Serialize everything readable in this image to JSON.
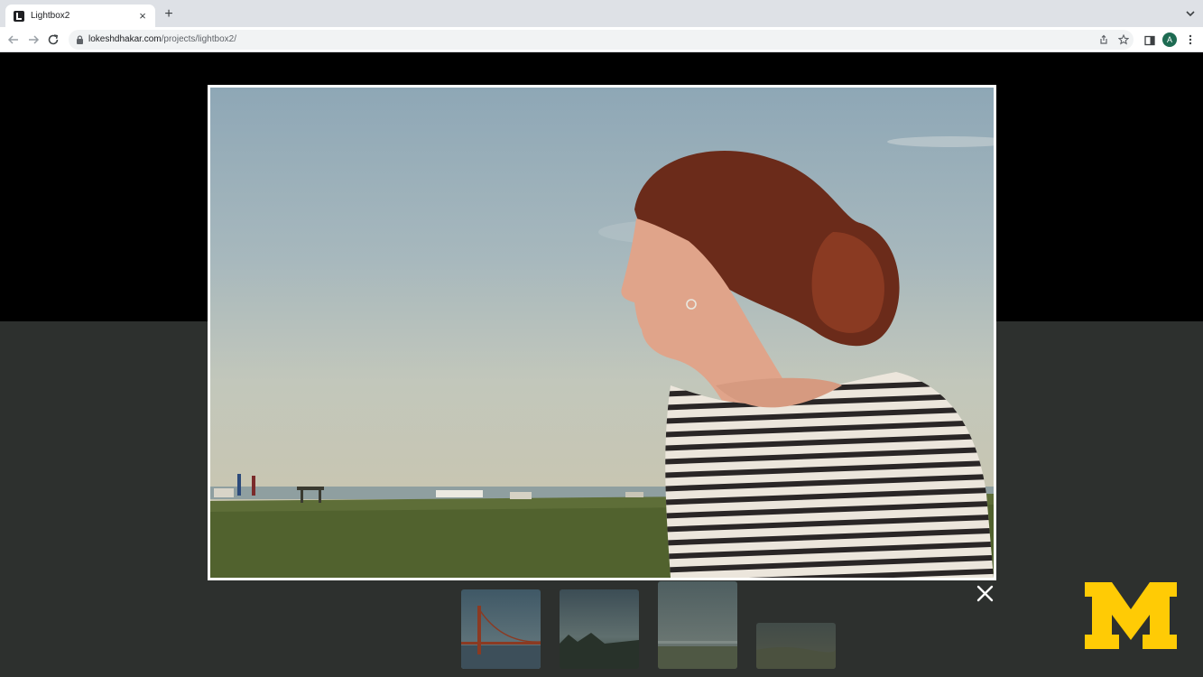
{
  "browser": {
    "tab": {
      "title": "Lightbox2",
      "close_icon": "close-icon"
    },
    "new_tab_icon": "plus-icon",
    "address_bar": {
      "domain": "lokeshdhakar.com",
      "path": "/projects/lightbox2/"
    },
    "profile_initial": "A",
    "colors": {
      "profile": "#1e6b52",
      "tab_strip": "#dee1e6"
    }
  },
  "lightbox": {
    "image_description_icon": "photo-woman-striped-shirt",
    "thumbnails": [
      {
        "icon": "thumbnail-golden-gate-bridge"
      },
      {
        "icon": "thumbnail-misty-landscape"
      },
      {
        "icon": "thumbnail-hazy-shoreline"
      },
      {
        "icon": "thumbnail-faded-landscape"
      }
    ],
    "close_icon": "close-icon",
    "colors": {
      "overlay": "#2d302e",
      "frame": "#ffffff"
    }
  },
  "watermark": {
    "logo": "university-of-michigan-block-m-logo",
    "color": "#ffcb05"
  }
}
